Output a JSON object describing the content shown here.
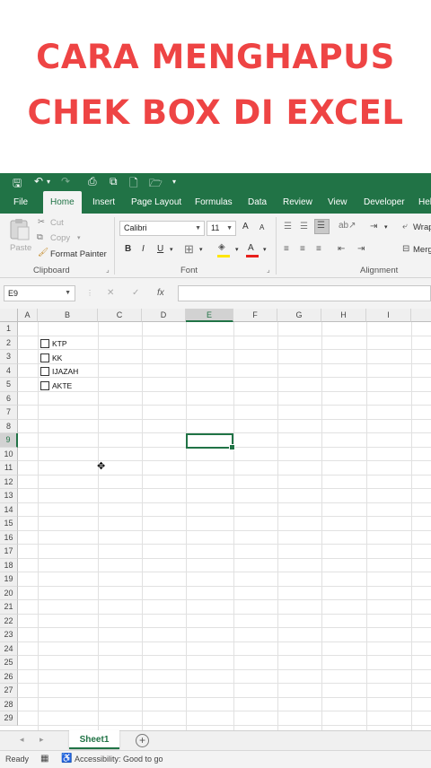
{
  "banner": {
    "line1": "CARA MENGHAPUS",
    "line2": "CHEK BOX DI EXCEL",
    "color": "#ee4444"
  },
  "app": {
    "accent": "#217346"
  },
  "qat": {
    "save": "🖫",
    "undo": "↶",
    "undo_dd": "▾",
    "redo": "↷",
    "icon1": "⎙",
    "icon2": "⧉",
    "new": "🗋",
    "open": "🗁",
    "more": "▾"
  },
  "tabs": [
    "File",
    "Home",
    "Insert",
    "Page Layout",
    "Formulas",
    "Data",
    "Review",
    "View",
    "Developer",
    "Help"
  ],
  "active_tab": "Home",
  "ribbon": {
    "clipboard": {
      "paste": "Paste",
      "cut": "Cut",
      "copy": "Copy",
      "format_painter": "Format Painter",
      "group": "Clipboard"
    },
    "font": {
      "name": "Calibri",
      "size": "11",
      "grow": "A",
      "shrink": "A",
      "bold": "B",
      "italic": "I",
      "underline": "U",
      "group": "Font"
    },
    "alignment": {
      "wrap": "Wrap",
      "merge": "Merg",
      "group": "Alignment"
    }
  },
  "formula_bar": {
    "name_box": "E9",
    "cancel": "✕",
    "enter": "✓",
    "fx": "fx",
    "value": ""
  },
  "columns": [
    "A",
    "B",
    "C",
    "D",
    "E",
    "F",
    "G",
    "H",
    "I"
  ],
  "selected_column": "E",
  "rows": [
    "1",
    "2",
    "3",
    "4",
    "5",
    "6",
    "7",
    "8",
    "9",
    "10",
    "11",
    "12",
    "13",
    "14",
    "15",
    "16",
    "17",
    "18",
    "19",
    "20",
    "21",
    "22",
    "23",
    "24",
    "25",
    "26",
    "27",
    "28",
    "29"
  ],
  "selected_row": "9",
  "checkboxes": [
    {
      "label": "KTP",
      "checked": false
    },
    {
      "label": "KK",
      "checked": false
    },
    {
      "label": "IJAZAH",
      "checked": false
    },
    {
      "label": "AKTE",
      "checked": false
    }
  ],
  "sheet_tabs": {
    "active": "Sheet1",
    "add": "+"
  },
  "status": {
    "ready": "Ready",
    "accessibility": "Accessibility: Good to go"
  }
}
